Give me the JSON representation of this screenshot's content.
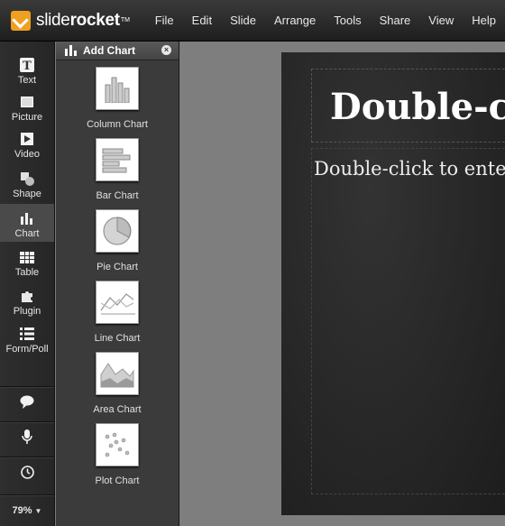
{
  "app": {
    "logo_light": "slide",
    "logo_bold": "rocket",
    "logo_tm": "TM"
  },
  "menu": [
    "File",
    "Edit",
    "Slide",
    "Arrange",
    "Tools",
    "Share",
    "View",
    "Help"
  ],
  "tools": [
    {
      "label": "Text",
      "icon": "text-icon"
    },
    {
      "label": "Picture",
      "icon": "picture-icon"
    },
    {
      "label": "Video",
      "icon": "video-icon"
    },
    {
      "label": "Shape",
      "icon": "shape-icon"
    },
    {
      "label": "Chart",
      "icon": "chart-icon",
      "active": true
    },
    {
      "label": "Table",
      "icon": "table-icon"
    },
    {
      "label": "Plugin",
      "icon": "plugin-icon"
    },
    {
      "label": "Form/Poll",
      "icon": "form-poll-icon"
    }
  ],
  "rail_buttons": [
    {
      "icon": "speech-bubble-icon"
    },
    {
      "icon": "microphone-icon"
    },
    {
      "icon": "clock-icon"
    }
  ],
  "zoom": {
    "value": "79%",
    "caret": "▼"
  },
  "panel": {
    "title": "Add Chart",
    "close": "×",
    "charts": [
      {
        "label": "Column Chart",
        "icon": "column-chart-icon"
      },
      {
        "label": "Bar Chart",
        "icon": "bar-chart-icon"
      },
      {
        "label": "Pie Chart",
        "icon": "pie-chart-icon"
      },
      {
        "label": "Line Chart",
        "icon": "line-chart-icon"
      },
      {
        "label": "Area Chart",
        "icon": "area-chart-icon"
      },
      {
        "label": "Plot Chart",
        "icon": "plot-chart-icon"
      }
    ]
  },
  "slide": {
    "title": "Double-click to enter title",
    "body": "Double-click to enter text"
  },
  "colors": {
    "accent": "#f0a020",
    "rail_bg": "#2a2a2a",
    "panel_bg": "#3b3b3b",
    "slide_bg": "#262626"
  }
}
